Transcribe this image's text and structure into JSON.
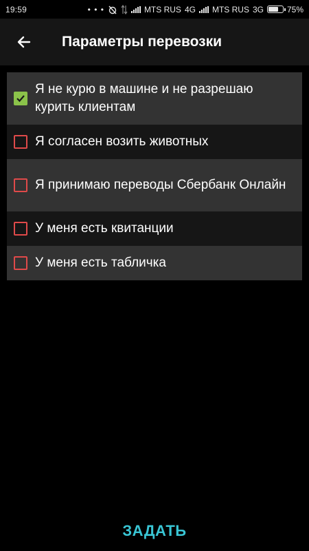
{
  "status_bar": {
    "time": "19:59",
    "notification_dots": "• • •",
    "carrier1": "MTS RUS",
    "network1": "4G",
    "carrier2": "MTS RUS",
    "network2": "3G",
    "battery_percent": 75,
    "battery_text": "75%"
  },
  "appbar": {
    "title": "Параметры перевозки",
    "back_icon": "arrow-left-icon"
  },
  "options": [
    {
      "label": "Я не курю в машине и не разрешаю курить клиентам",
      "checked": true
    },
    {
      "label": "Я согласен возить животных",
      "checked": false
    },
    {
      "label": "Я принимаю переводы Сбербанк Онлайн",
      "checked": false
    },
    {
      "label": "У меня есть квитанции",
      "checked": false
    },
    {
      "label": "У меня есть табличка",
      "checked": false
    }
  ],
  "submit_label": "ЗАДАТЬ",
  "colors": {
    "accent": "#39c5d4",
    "checkbox_checked": "#8bc34a",
    "checkbox_unchecked_border": "#e04a4a"
  }
}
